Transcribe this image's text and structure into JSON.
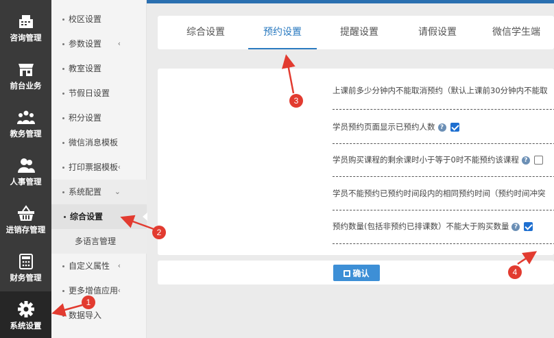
{
  "rail": {
    "items": [
      {
        "label": "咨询管理",
        "icon": "cash-register-icon"
      },
      {
        "label": "前台业务",
        "icon": "storefront-icon"
      },
      {
        "label": "教务管理",
        "icon": "group-icon"
      },
      {
        "label": "人事管理",
        "icon": "people-icon"
      },
      {
        "label": "进销存管理",
        "icon": "basket-icon"
      },
      {
        "label": "财务管理",
        "icon": "calculator-icon"
      },
      {
        "label": "系统设置",
        "icon": "gear-icon"
      }
    ]
  },
  "submenu": {
    "items": [
      {
        "label": "校区设置"
      },
      {
        "label": "参数设置",
        "chevron": "‹"
      },
      {
        "label": "教室设置"
      },
      {
        "label": "节假日设置"
      },
      {
        "label": "积分设置"
      },
      {
        "label": "微信消息模板"
      },
      {
        "label": "打印票据模板",
        "chevron": "‹"
      },
      {
        "label": "系统配置",
        "chevron": "⌄"
      },
      {
        "label": "综合设置"
      },
      {
        "label": "多语言管理"
      },
      {
        "label": "自定义属性",
        "chevron": "‹"
      },
      {
        "label": "更多增值应用",
        "chevron": "‹"
      },
      {
        "label": "数据导入"
      }
    ]
  },
  "tabs": [
    {
      "label": "综合设置"
    },
    {
      "label": "预约设置"
    },
    {
      "label": "提醒设置"
    },
    {
      "label": "请假设置"
    },
    {
      "label": "微信学生端"
    }
  ],
  "settings": {
    "rows": [
      {
        "text": "上课前多少分钟内不能取消预约（默认上课前30分钟内不能取"
      },
      {
        "text": "学员预约页面显示已预约人数",
        "help": "?",
        "checked": true
      },
      {
        "text": "学员购买课程的剩余课时小于等于0时不能预约该课程",
        "help": "?",
        "checked": false
      },
      {
        "text": "学员不能预约已预约时间段内的相同预约时间（预约时间冲突"
      },
      {
        "text": "预约数量(包括非预约已排课数）不能大于购买数量",
        "help": "?",
        "checked": true
      }
    ]
  },
  "confirm_label": "确认",
  "badges": [
    "1",
    "2",
    "3",
    "4"
  ],
  "colors": {
    "accent": "#2a7ac0",
    "annotation": "#e23b30",
    "rail": "#3a3a3a"
  }
}
